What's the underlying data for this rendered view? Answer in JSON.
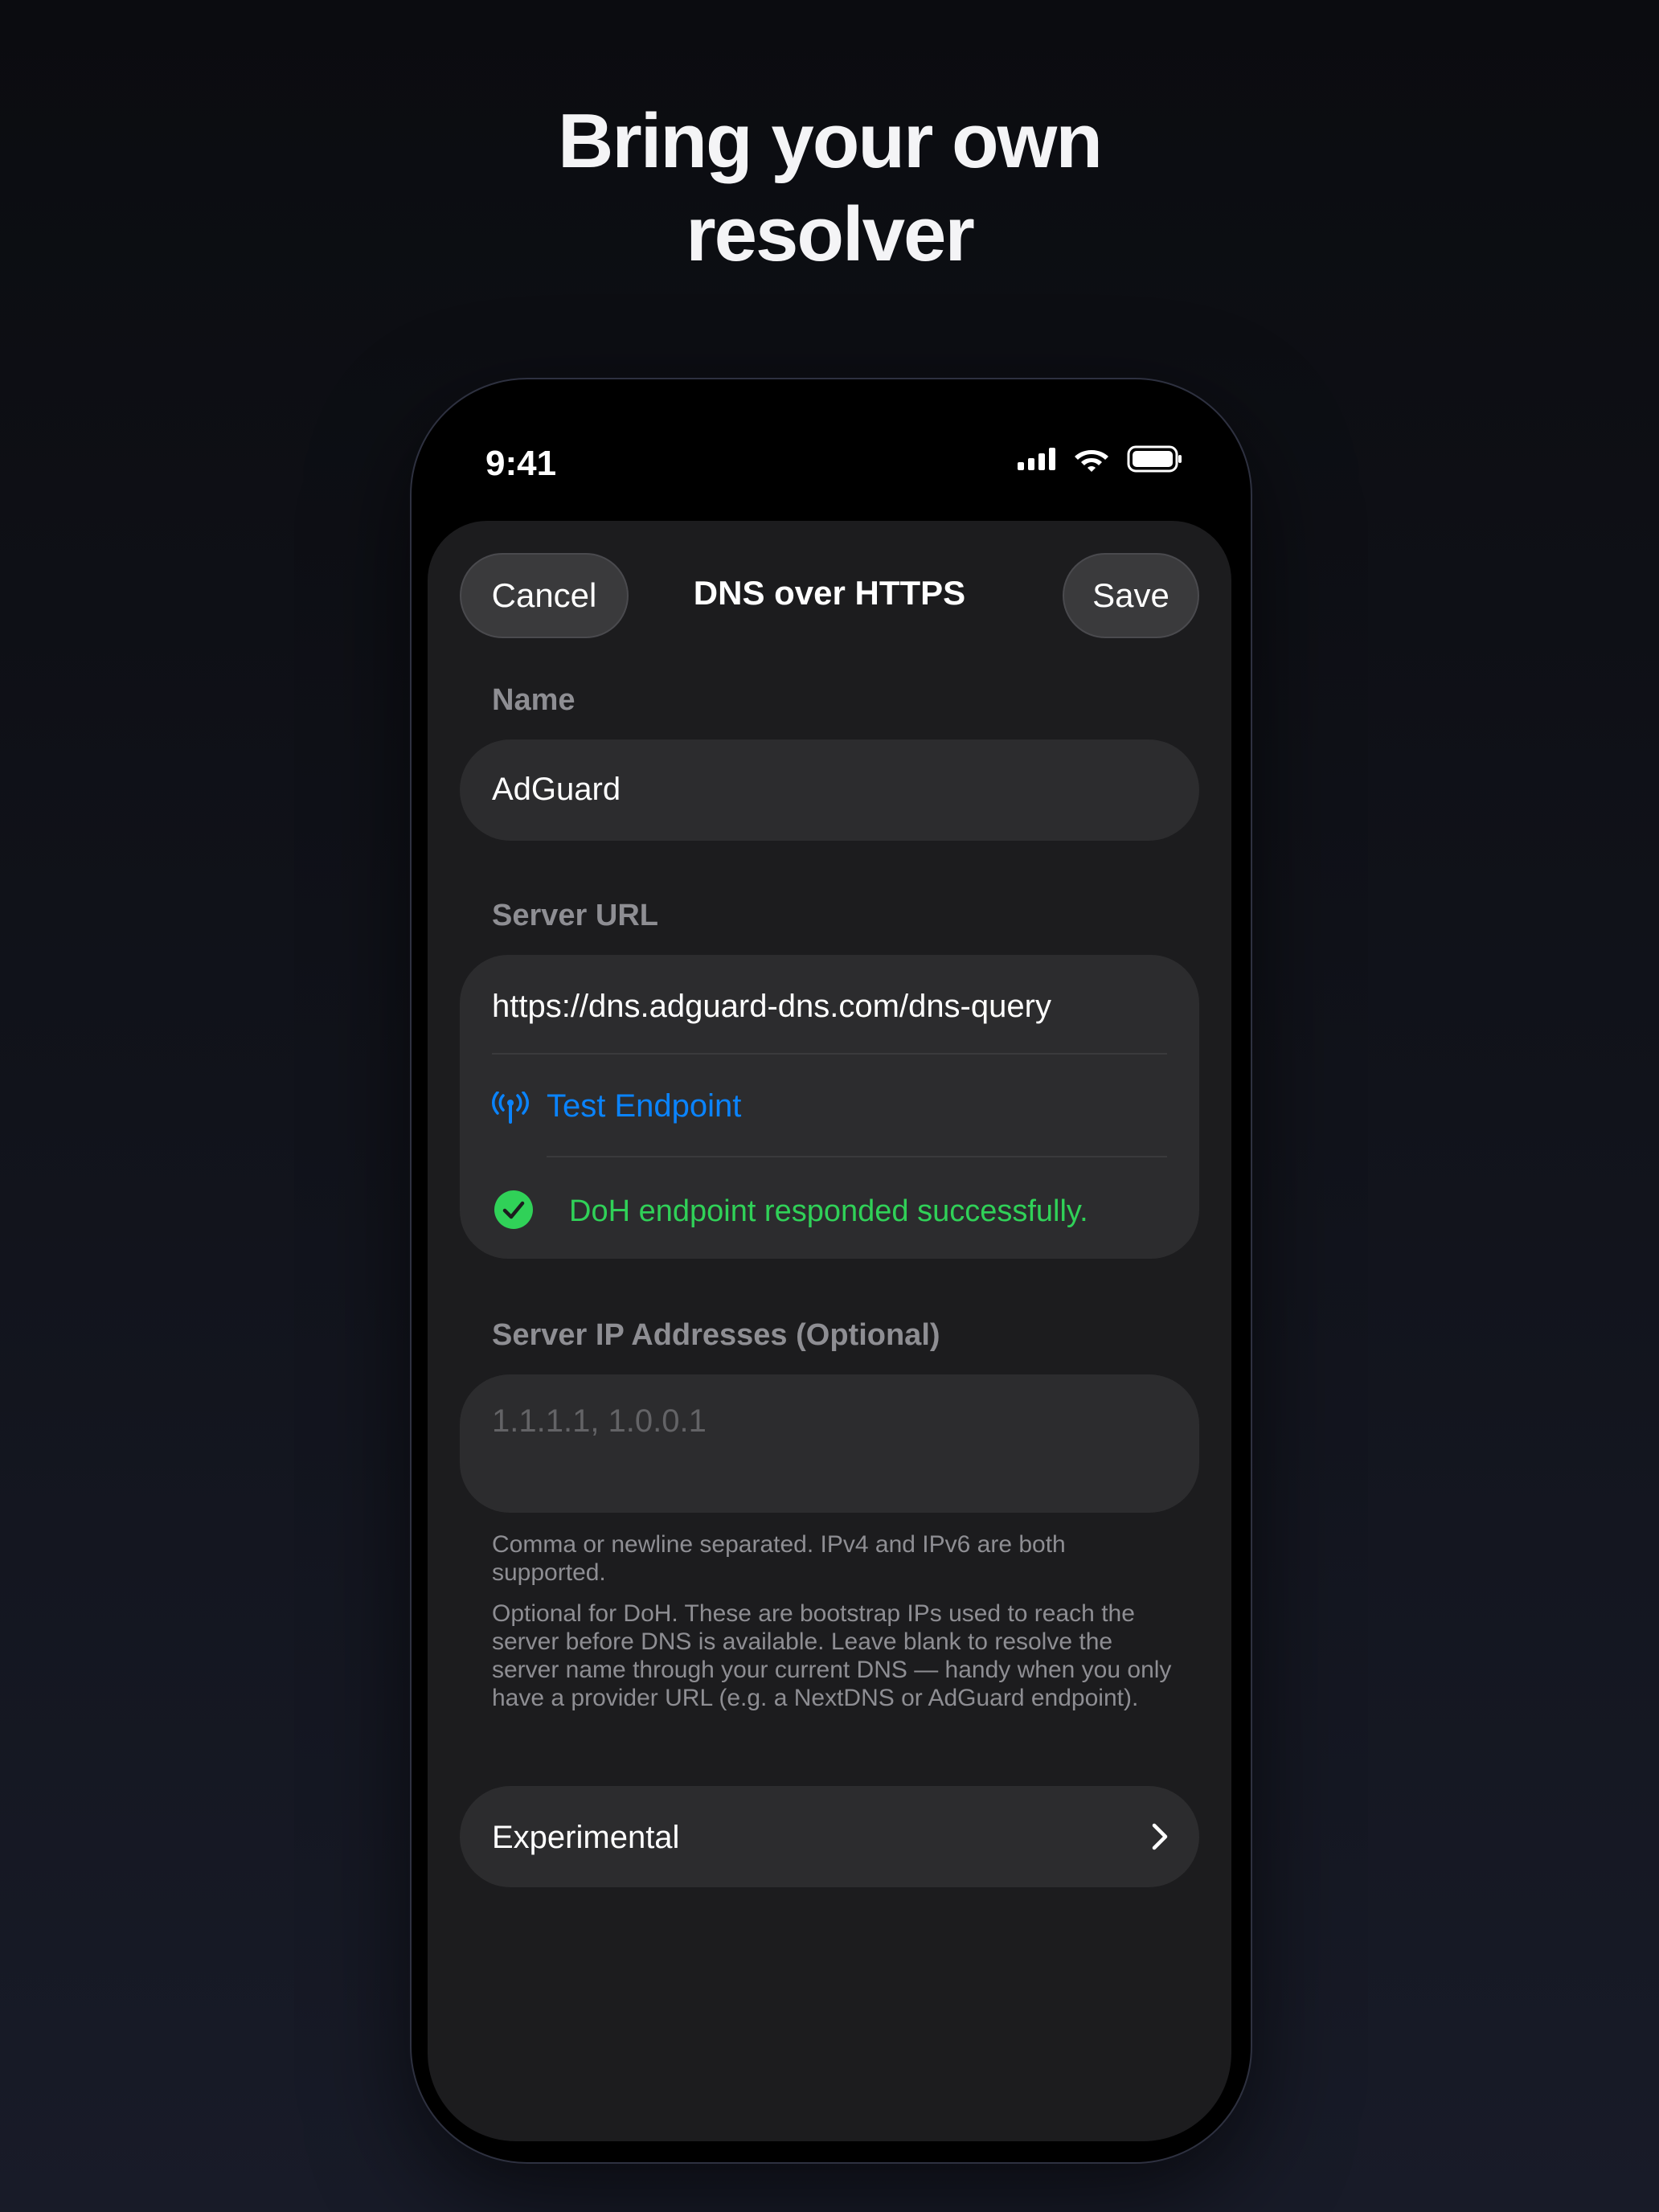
{
  "headline": {
    "line1": "Bring your own",
    "line2": "resolver"
  },
  "status_bar": {
    "time": "9:41",
    "icons": [
      "signal-icon",
      "wifi-icon",
      "battery-icon"
    ]
  },
  "nav": {
    "cancel_label": "Cancel",
    "title": "DNS over HTTPS",
    "save_label": "Save"
  },
  "name_section": {
    "label": "Name",
    "value": "AdGuard"
  },
  "server_url_section": {
    "label": "Server URL",
    "value": "https://dns.adguard-dns.com/dns-query",
    "test_label": "Test Endpoint",
    "status_message": "DoH endpoint responded successfully."
  },
  "server_ip_section": {
    "label": "Server IP Addresses (Optional)",
    "placeholder": "1.1.1.1, 1.0.0.1",
    "help1": "Comma or newline separated. IPv4 and IPv6 are both supported.",
    "help2": "Optional for DoH. These are bootstrap IPs used to reach the server before DNS is available. Leave blank to resolve the server name through your current DNS — handy when you only have a provider URL (e.g. a NextDNS or AdGuard endpoint)."
  },
  "experimental": {
    "label": "Experimental"
  },
  "colors": {
    "accent": "#0a84ff",
    "success": "#30d158",
    "card": "#1c1c1e",
    "field": "#2c2c2e"
  }
}
